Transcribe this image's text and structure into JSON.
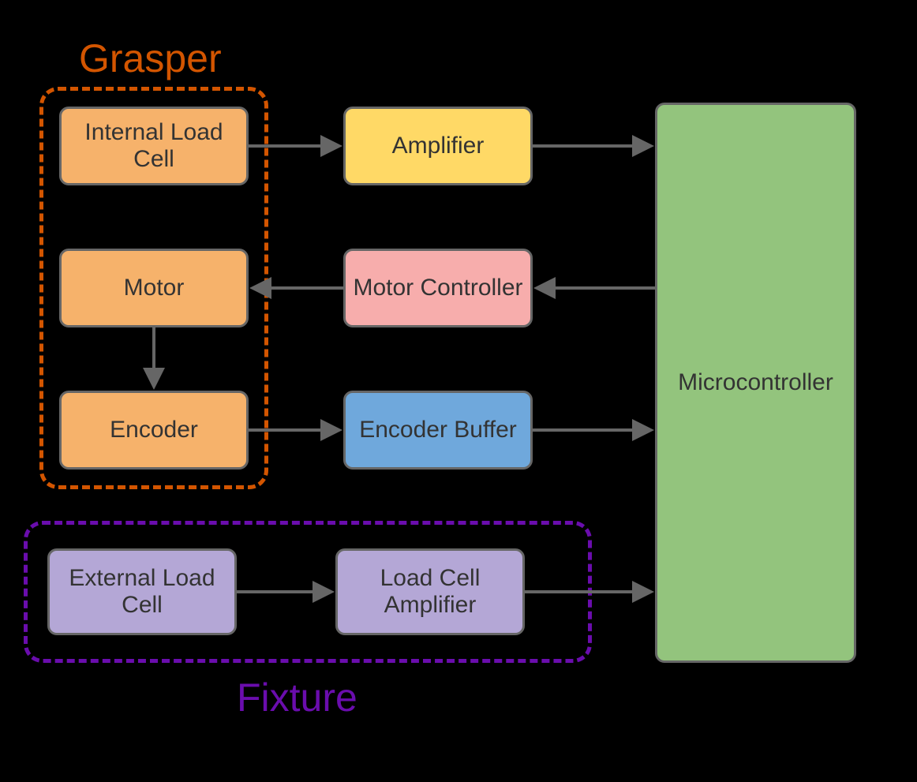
{
  "groups": {
    "grasper": {
      "label": "Grasper"
    },
    "fixture": {
      "label": "Fixture"
    }
  },
  "blocks": {
    "internalLoadCell": "Internal Load Cell",
    "amplifier": "Amplifier",
    "motor": "Motor",
    "motorController": "Motor Controller",
    "encoder": "Encoder",
    "encoderBuffer": "Encoder Buffer",
    "externalLoadCell": "External Load Cell",
    "loadCellAmplifier": "Load Cell Amplifier",
    "microcontroller": "Microcontroller"
  },
  "colors": {
    "orangeFill": "#f6b26b",
    "yellowFill": "#ffd966",
    "pinkFill": "#f7adac",
    "blueFill": "#6fa8dc",
    "purpleFill": "#b4a7d6",
    "greenFill": "#93c47d",
    "blockBorder": "#666666",
    "arrow": "#666666",
    "grasperBorder": "#d35500",
    "fixtureBorder": "#6a0dad"
  },
  "connections": [
    {
      "from": "internalLoadCell",
      "to": "amplifier"
    },
    {
      "from": "amplifier",
      "to": "microcontroller"
    },
    {
      "from": "microcontroller",
      "to": "motorController"
    },
    {
      "from": "motorController",
      "to": "motor"
    },
    {
      "from": "motor",
      "to": "encoder"
    },
    {
      "from": "encoder",
      "to": "encoderBuffer"
    },
    {
      "from": "encoderBuffer",
      "to": "microcontroller"
    },
    {
      "from": "externalLoadCell",
      "to": "loadCellAmplifier"
    },
    {
      "from": "loadCellAmplifier",
      "to": "microcontroller"
    }
  ]
}
